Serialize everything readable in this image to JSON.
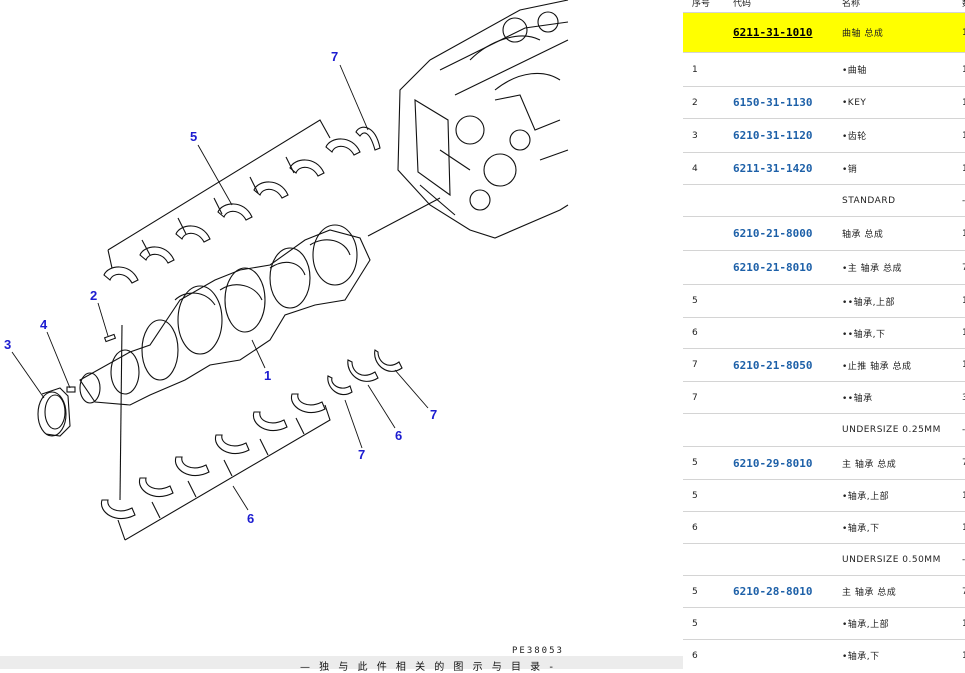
{
  "diagram": {
    "callouts": [
      {
        "id": "7a",
        "label": "7"
      },
      {
        "id": "5",
        "label": "5"
      },
      {
        "id": "2",
        "label": "2"
      },
      {
        "id": "4",
        "label": "4"
      },
      {
        "id": "3",
        "label": "3"
      },
      {
        "id": "1",
        "label": "1"
      },
      {
        "id": "7b",
        "label": "7"
      },
      {
        "id": "6a",
        "label": "6"
      },
      {
        "id": "7c",
        "label": "7"
      },
      {
        "id": "6b",
        "label": "6"
      }
    ],
    "drawing_code": "PE38053",
    "bottom_note": "— 独 与 此 件 相 关 的 图 示 与 目 录 -"
  },
  "parts_table": {
    "headers": {
      "no": "序号",
      "code": "代码",
      "name": "名称",
      "qty": "数"
    },
    "rows": [
      {
        "no": "",
        "code": "6211-31-1010",
        "name": "曲轴 总成",
        "qty": "1",
        "highlight": true
      },
      {
        "no": "1",
        "code": "",
        "name": "•曲轴",
        "qty": "1"
      },
      {
        "no": "2",
        "code": "6150-31-1130",
        "name": "•KEY",
        "qty": "1"
      },
      {
        "no": "3",
        "code": "6210-31-1120",
        "name": "•齿轮",
        "qty": "1"
      },
      {
        "no": "4",
        "code": "6211-31-1420",
        "name": "•销",
        "qty": "1"
      },
      {
        "no": "",
        "code": "",
        "name": "STANDARD",
        "qty": "-"
      },
      {
        "no": "",
        "code": "6210-21-8000",
        "name": "轴承 总成",
        "qty": "1"
      },
      {
        "no": "",
        "code": "6210-21-8010",
        "name": "•主 轴承 总成",
        "qty": "7"
      },
      {
        "no": "5",
        "code": "",
        "name": "••轴承,上部",
        "qty": "1"
      },
      {
        "no": "6",
        "code": "",
        "name": "••轴承,下",
        "qty": "1"
      },
      {
        "no": "7",
        "code": "6210-21-8050",
        "name": "•止推 轴承 总成",
        "qty": "1"
      },
      {
        "no": "7",
        "code": "",
        "name": "••轴承",
        "qty": "3"
      },
      {
        "no": "",
        "code": "",
        "name": "UNDERSIZE 0.25MM",
        "qty": "-"
      },
      {
        "no": "5",
        "code": "6210-29-8010",
        "name": "主 轴承 总成",
        "qty": "7"
      },
      {
        "no": "5",
        "code": "",
        "name": "•轴承,上部",
        "qty": "1"
      },
      {
        "no": "6",
        "code": "",
        "name": "•轴承,下",
        "qty": "1"
      },
      {
        "no": "",
        "code": "",
        "name": "UNDERSIZE 0.50MM",
        "qty": "-"
      },
      {
        "no": "5",
        "code": "6210-28-8010",
        "name": "主 轴承 总成",
        "qty": "7"
      },
      {
        "no": "5",
        "code": "",
        "name": "•轴承,上部",
        "qty": "1"
      },
      {
        "no": "6",
        "code": "",
        "name": "•轴承,下",
        "qty": "1"
      }
    ]
  }
}
